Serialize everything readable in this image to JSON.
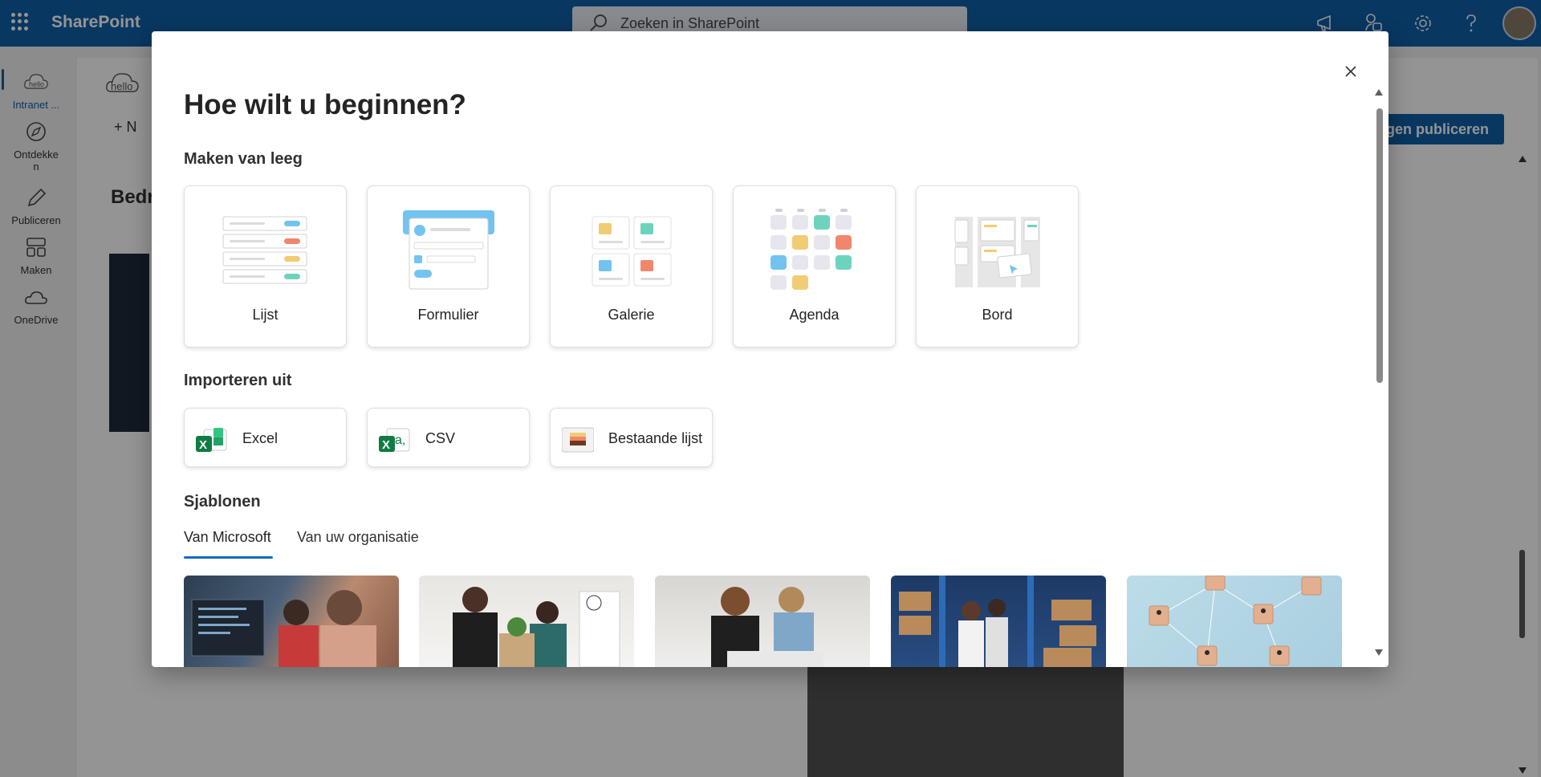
{
  "topbar": {
    "app_name": "SharePoint",
    "search_placeholder": "Zoeken in SharePoint",
    "icons": [
      "waffle-icon",
      "megaphone-icon",
      "share-icon",
      "gear-icon",
      "help-icon"
    ]
  },
  "rail": {
    "items": [
      {
        "label": "Intranet ...",
        "icon": "hello-cloud-icon"
      },
      {
        "label": "Ontdekken",
        "icon": "compass-icon"
      },
      {
        "label": "Publiceren",
        "icon": "pen-icon"
      },
      {
        "label": "Maken",
        "icon": "grid-icon"
      },
      {
        "label": "OneDrive",
        "icon": "cloud-icon"
      }
    ]
  },
  "background": {
    "new_label": "N",
    "heading": "Bedr",
    "publish_label": "ngen publiceren",
    "hello_text": "hello"
  },
  "dialog": {
    "title": "Hoe wilt u beginnen?",
    "section_blank": "Maken van leeg",
    "blank_cards": [
      {
        "label": "Lijst"
      },
      {
        "label": "Formulier"
      },
      {
        "label": "Galerie"
      },
      {
        "label": "Agenda"
      },
      {
        "label": "Bord"
      }
    ],
    "section_import": "Importeren uit",
    "import_cards": [
      {
        "label": "Excel",
        "icon": "excel-icon"
      },
      {
        "label": "CSV",
        "icon": "csv-icon"
      },
      {
        "label": "Bestaande lijst",
        "icon": "existing-list-icon"
      }
    ],
    "section_templates": "Sjablonen",
    "tabs": [
      {
        "label": "Van Microsoft",
        "active": true
      },
      {
        "label": "Van uw organisatie",
        "active": false
      }
    ],
    "template_count": 5
  },
  "colors": {
    "brand": "#0f5fa8",
    "accent": "#0f6cbd",
    "pill_blue": "#72c3f0",
    "pill_red": "#f0876c",
    "pill_yellow": "#f2cc74",
    "pill_green": "#6dd3bd"
  }
}
